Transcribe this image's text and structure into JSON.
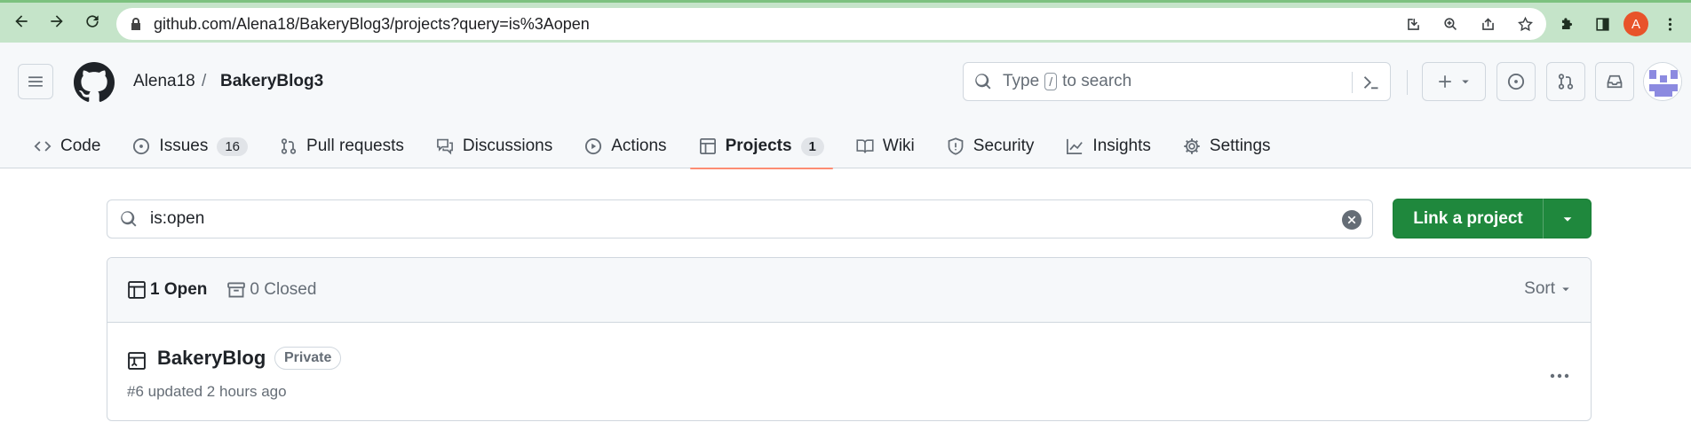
{
  "browser": {
    "url": "github.com/Alena18/BakeryBlog3/projects?query=is%3Aopen",
    "profile_initial": "A"
  },
  "header": {
    "owner": "Alena18",
    "separator": "/",
    "repo": "BakeryBlog3",
    "search_prefix": "Type",
    "search_key": "/",
    "search_suffix": "to search"
  },
  "tabs": [
    {
      "label": "Code",
      "icon": "code-icon"
    },
    {
      "label": "Issues",
      "icon": "issue-opened-icon",
      "counter": "16"
    },
    {
      "label": "Pull requests",
      "icon": "git-pull-request-icon"
    },
    {
      "label": "Discussions",
      "icon": "comment-discussion-icon"
    },
    {
      "label": "Actions",
      "icon": "play-icon"
    },
    {
      "label": "Projects",
      "icon": "table-icon",
      "counter": "1",
      "selected": true
    },
    {
      "label": "Wiki",
      "icon": "book-icon"
    },
    {
      "label": "Security",
      "icon": "shield-icon"
    },
    {
      "label": "Insights",
      "icon": "graph-icon"
    },
    {
      "label": "Settings",
      "icon": "gear-icon"
    }
  ],
  "filter": {
    "value": "is:open"
  },
  "actions": {
    "link_project_label": "Link a project"
  },
  "list": {
    "open_label": "1 Open",
    "closed_label": "0 Closed",
    "sort_label": "Sort",
    "projects": [
      {
        "title": "BakeryBlog",
        "visibility": "Private",
        "meta": "#6 updated 2 hours ago"
      }
    ]
  },
  "colors": {
    "primary_button": "#1f883d",
    "selected_tab_underline": "#fd8c73",
    "browser_frame": "#c5e4c9"
  }
}
